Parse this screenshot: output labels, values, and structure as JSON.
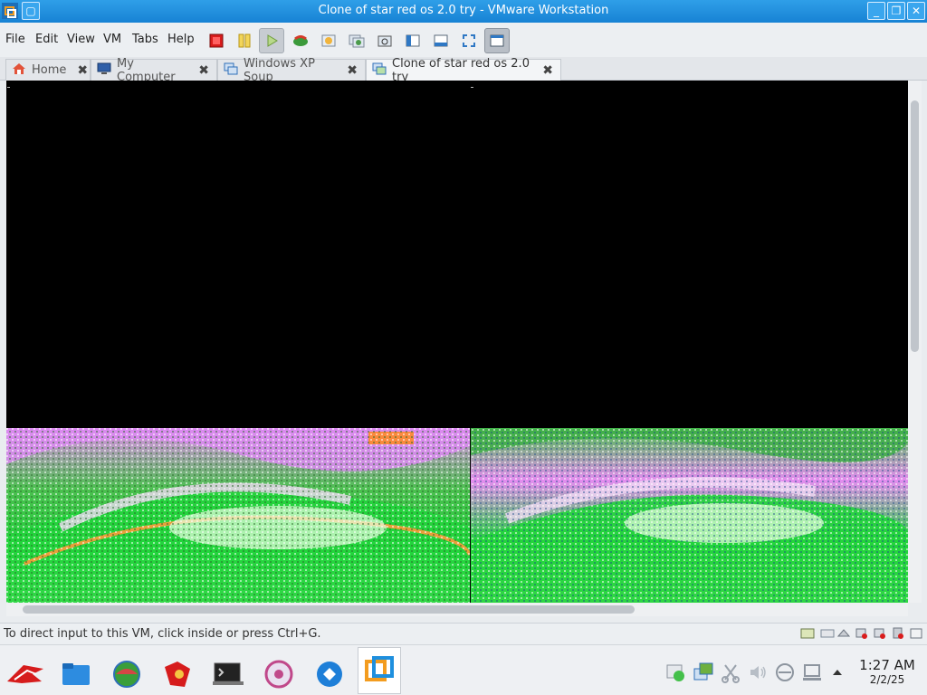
{
  "window": {
    "title": "Clone of star red os 2.0 try - VMware Workstation",
    "minimize_label": "_",
    "restore_label": "❐",
    "close_label": "✕"
  },
  "menu": [
    "File",
    "Edit",
    "View",
    "VM",
    "Tabs",
    "Help"
  ],
  "toolbar_icons": [
    "power-off-icon",
    "suspend-icon",
    "play-icon",
    "snapshot-icon",
    "revert-snapshot-icon",
    "manage-snapshots-icon",
    "capture-icon",
    "sidebar-icon",
    "thumbnail-bar-icon",
    "fullscreen-icon",
    "unity-view-icon"
  ],
  "tabs": [
    {
      "label": "Home",
      "icon": "home-icon"
    },
    {
      "label": "My Computer",
      "icon": "computer-icon"
    },
    {
      "label": "Windows XP Soup",
      "icon": "vm-icon"
    },
    {
      "label": "Clone of star red os 2.0 try",
      "icon": "vm-icon",
      "active": true
    }
  ],
  "tab_close_glyph": "✖",
  "status": {
    "message": "To direct input to this VM, click inside or press Ctrl+G.",
    "device_icons": [
      "hdd-icon",
      "cd-icon",
      "network-icon",
      "usb-icon",
      "sound-icon",
      "printer-icon",
      "display-icon",
      "message-icon"
    ]
  },
  "taskbar": {
    "apps": [
      "red-os-menu-icon",
      "file-manager-icon",
      "browser-icon",
      "settings-icon",
      "terminal-icon",
      "media-icon",
      "remote-icon",
      "vmware-icon"
    ],
    "tray": [
      "network-status-icon",
      "vmware-tray-icon",
      "screenshot-icon",
      "volume-icon",
      "keyboard-icon",
      "display-settings-icon",
      "expand-tray-icon"
    ],
    "time": "1:27 AM",
    "date": "2/2/25"
  },
  "colors": {
    "titlebar": "#1e8fde",
    "vm_background": "#000000",
    "glitch_green": "#1ed33a",
    "glitch_pink": "#e48cf0"
  }
}
